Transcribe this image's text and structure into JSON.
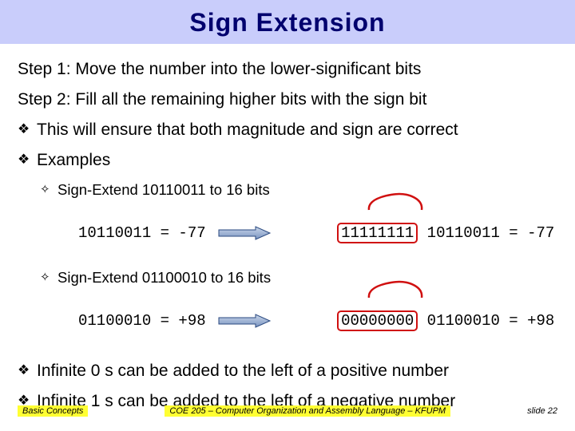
{
  "title": "Sign Extension",
  "step1": "Step 1: Move the number into the lower-significant bits",
  "step2": "Step 2: Fill all the remaining higher bits with the sign bit",
  "bullet_ensure": "This will ensure that both magnitude and sign are correct",
  "bullet_examples": "Examples",
  "ex1_label": "Sign-Extend 10110011 to 16 bits",
  "ex1_left": "10110011 = -77",
  "ex1_right_high": "11111111",
  "ex1_right_rest": " 10110011 = -77",
  "ex2_label": "Sign-Extend 01100010 to 16 bits",
  "ex2_left": "01100010 = +98",
  "ex2_right_high": "00000000",
  "ex2_right_rest": " 01100010 = +98",
  "bullet_inf0": "Infinite 0 s can be added to the left of a positive number",
  "bullet_inf1": "Infinite 1 s can be added to the left of a negative number",
  "footer_left": "Basic Concepts",
  "footer_center": "COE 205 – Computer Organization and Assembly Language – KFUPM",
  "footer_right": "slide 22"
}
